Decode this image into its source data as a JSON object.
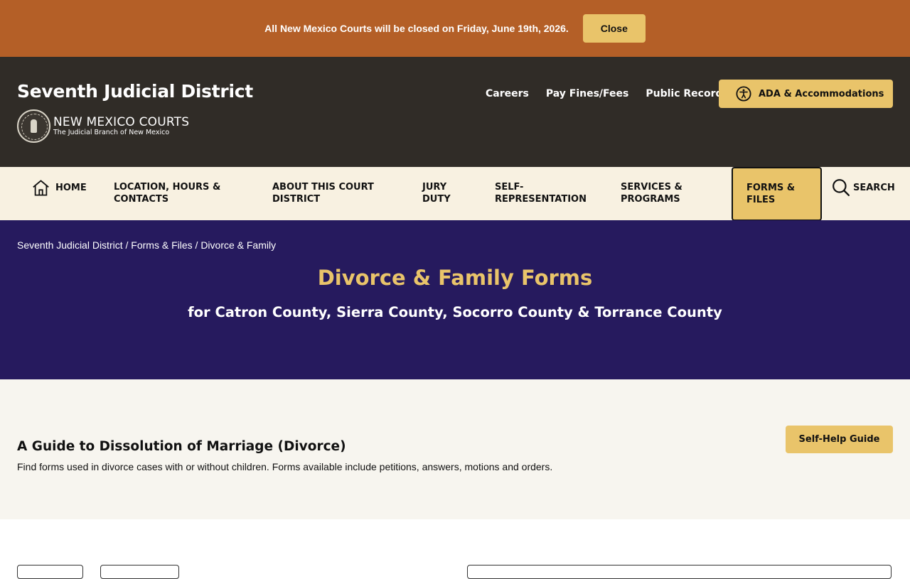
{
  "alert": {
    "message": "All New Mexico Courts will be closed on Friday, June 19th, 2026.",
    "close_label": "Close"
  },
  "header": {
    "site_title": "Seventh Judicial District",
    "brand_name": "NEW MEXICO COURTS",
    "brand_tagline": "The Judicial Branch of New Mexico",
    "links": [
      {
        "label": "Careers"
      },
      {
        "label": "Pay Fines/Fees"
      },
      {
        "label": "Public Records"
      }
    ],
    "ada_label": "ADA & Accommodations"
  },
  "nav": {
    "items": [
      {
        "label": "HOME",
        "icon": "home-icon"
      },
      {
        "label": "LOCATION, HOURS & CONTACTS"
      },
      {
        "label": "ABOUT THIS COURT DISTRICT"
      },
      {
        "label": "JURY DUTY"
      },
      {
        "label": "SELF-REPRESENTATION"
      },
      {
        "label": "SERVICES & PROGRAMS"
      },
      {
        "label": "FORMS & FILES",
        "active": true
      },
      {
        "label": "SEARCH",
        "icon": "search-icon"
      }
    ]
  },
  "breadcrumb": {
    "items": [
      "Seventh Judicial District",
      "Forms & Files",
      "Divorce & Family"
    ],
    "separator": "/"
  },
  "hero": {
    "title": "Divorce & Family Forms",
    "subtitle": "for Catron County, Sierra County, Socorro County & Torrance County"
  },
  "section": {
    "title": "A Guide to Dissolution of Marriage (Divorce)",
    "description": "Find forms used in divorce cases with or without children. Forms available include petitions, answers, motions and orders.",
    "button_label": "Self-Help Guide"
  },
  "colors": {
    "alert_bg": "#b45f27",
    "header_bg": "#302c27",
    "nav_bg": "#f8f1e1",
    "hero_bg": "#261a5e",
    "accent_gold": "#e9c46a",
    "section_bg": "#f7f5ef"
  }
}
